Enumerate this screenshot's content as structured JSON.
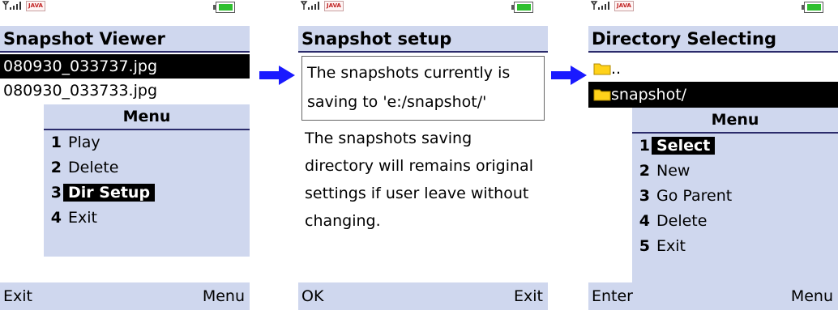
{
  "colors": {
    "title_bg": "#cfd7ee",
    "selected_bg": "#000000",
    "arrow": "#1a1aff",
    "battery": "#2fbf2f",
    "folder": "#ffd21a"
  },
  "status": {
    "java_badge": "JAVA"
  },
  "screens": [
    {
      "title": "Snapshot Viewer",
      "files": [
        {
          "name": "080930_033737.jpg",
          "selected": true
        },
        {
          "name": "080930_033733.jpg",
          "selected": false
        }
      ],
      "menu": {
        "title": "Menu",
        "items": [
          {
            "num": "1",
            "label": "Play"
          },
          {
            "num": "2",
            "label": "Delete"
          },
          {
            "num": "3",
            "label": "Dir Setup",
            "selected": true
          },
          {
            "num": "4",
            "label": "Exit"
          }
        ]
      },
      "softkeys": {
        "left": "Exit",
        "right": "Menu"
      }
    },
    {
      "title": "Snapshot setup",
      "info": "The snapshots currently is saving to 'e:/snapshot/'",
      "description": "The snapshots saving directory will remains original settings if user leave without changing.",
      "softkeys": {
        "left": "OK",
        "right": "Exit"
      }
    },
    {
      "title": "Directory Selecting",
      "dirs": [
        {
          "name": "..",
          "selected": false
        },
        {
          "name": "snapshot/",
          "selected": true
        }
      ],
      "menu": {
        "title": "Menu",
        "items": [
          {
            "num": "1",
            "label": "Select",
            "selected": true
          },
          {
            "num": "2",
            "label": "New"
          },
          {
            "num": "3",
            "label": "Go Parent"
          },
          {
            "num": "4",
            "label": "Delete"
          },
          {
            "num": "5",
            "label": "Exit"
          }
        ]
      },
      "softkeys": {
        "left": "Enter",
        "right": "Menu"
      }
    }
  ]
}
